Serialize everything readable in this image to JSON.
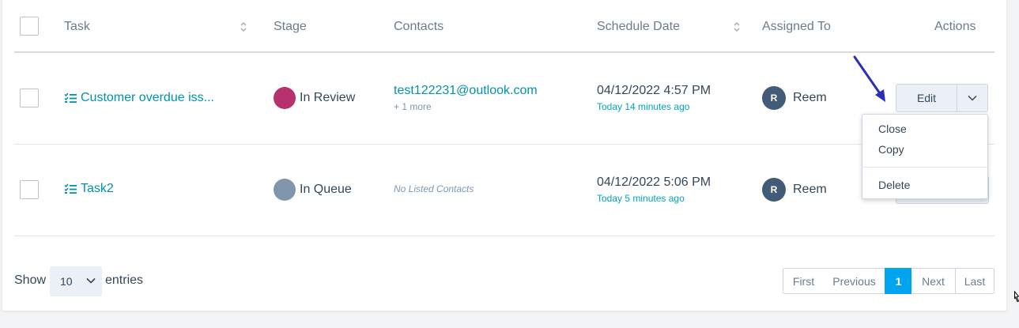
{
  "table": {
    "headers": {
      "task": "Task",
      "stage": "Stage",
      "contacts": "Contacts",
      "schedule_date": "Schedule Date",
      "assigned_to": "Assigned To",
      "actions": "Actions"
    },
    "rows": [
      {
        "task": "Customer overdue iss...",
        "stage": "In Review",
        "stage_color": "#b7326c",
        "contact": "test122231@outlook.com",
        "contact_more": "+ 1 more",
        "date": "04/12/2022 4:57 PM",
        "date_relative": "Today 14 minutes ago",
        "assignee_initial": "R",
        "assignee": "Reem"
      },
      {
        "task": "Task2",
        "stage": "In Queue",
        "stage_color": "#8096ab",
        "contact_none": "No Listed Contacts",
        "date": "04/12/2022 5:06 PM",
        "date_relative": "Today 5 minutes ago",
        "assignee_initial": "R",
        "assignee": "Reem"
      }
    ]
  },
  "actions": {
    "edit_label": "Edit",
    "menu": [
      "Close",
      "Copy",
      "Delete"
    ]
  },
  "footer": {
    "show_label": "Show",
    "entries_value": "10",
    "entries_label": "entries",
    "pagination": [
      "First",
      "Previous",
      "1",
      "Next",
      "Last"
    ]
  },
  "colors": {
    "link": "#0091ae",
    "active_page": "#00a4ef",
    "arrow": "#2b2fb8"
  }
}
